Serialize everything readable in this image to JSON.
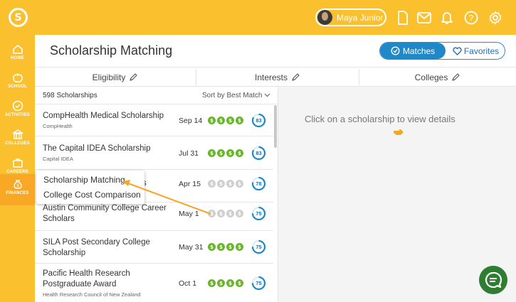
{
  "topbar": {
    "user_name": "Maya Junior",
    "icons": [
      "document-icon",
      "mail-icon",
      "bell-icon",
      "help-icon",
      "gear-icon"
    ]
  },
  "nav": {
    "items": [
      {
        "label": "HOME",
        "icon": "home-icon"
      },
      {
        "label": "SCHOOL",
        "icon": "apple-icon"
      },
      {
        "label": "ACTIVITIES",
        "icon": "check-icon"
      },
      {
        "label": "COLLEGES",
        "icon": "building-icon"
      },
      {
        "label": "CAREERS",
        "icon": "briefcase-icon"
      },
      {
        "label": "FINANCES",
        "icon": "money-bag-icon"
      }
    ]
  },
  "header": {
    "title": "Scholarship Matching",
    "toggle_matches": "Matches",
    "toggle_favorites": "Favorites"
  },
  "filters": {
    "eligibility": "Eligibility",
    "interests": "Interests",
    "colleges": "Colleges"
  },
  "list": {
    "count": "598 Scholarships",
    "sort": "Sort by Best Match",
    "rows": [
      {
        "title": "CompHealth Medical Scholarship",
        "sub": "CompHealth",
        "date": "Sep 14",
        "dollars_on": 4,
        "score": "83",
        "score_pct": 0.83
      },
      {
        "title": "The Capital IDEA Scholarship",
        "sub": "Capital IDEA",
        "date": "Jul 31",
        "dollars_on": 4,
        "score": "83",
        "score_pct": 0.83
      },
      {
        "title": "s",
        "sub": "",
        "date": "Apr 15",
        "dollars_on": 0,
        "score": "78",
        "score_pct": 0.78
      },
      {
        "title": "Austin Community College Career Scholars",
        "sub": "",
        "date": "May 1",
        "dollars_on": 0,
        "score": "75",
        "score_pct": 0.75
      },
      {
        "title": "SILA Post Secondary College Scholarship",
        "sub": "",
        "date": "May 31",
        "dollars_on": 4,
        "score": "75",
        "score_pct": 0.75
      },
      {
        "title": "Pacific Health Research Postgraduate Award",
        "sub": "Health Research Council of New Zealand",
        "date": "Oct 1",
        "dollars_on": 4,
        "score": "75",
        "score_pct": 0.75
      }
    ]
  },
  "detail": {
    "message": "Click on a scholarship to view details"
  },
  "dropdown": {
    "items": [
      "Scholarship Matching",
      "College Cost Comparison"
    ]
  },
  "colors": {
    "brand": "#fbc02d",
    "accent": "#1e88c8",
    "dollar_on": "#6ab42d",
    "chat": "#2e7d32",
    "arrow": "#f5a623"
  }
}
